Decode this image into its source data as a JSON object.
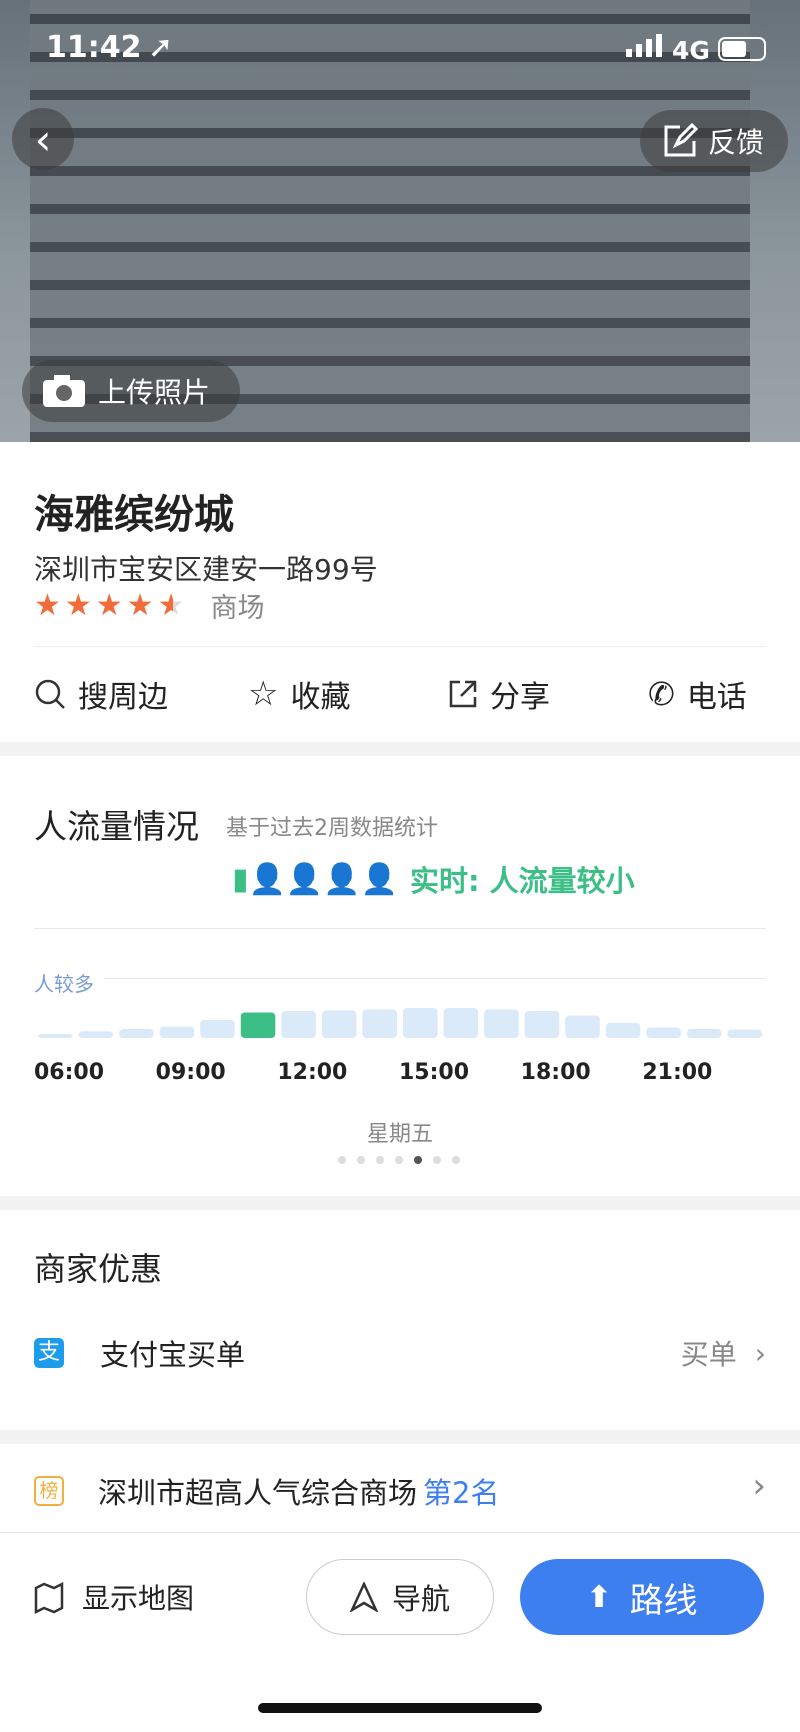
{
  "status": {
    "time": "11:42",
    "network": "4G"
  },
  "hero": {
    "feedback": "反馈",
    "upload": "上传照片"
  },
  "place": {
    "name": "海雅缤纷城",
    "address": "深圳市宝安区建安一路99号",
    "rating": 4.5,
    "category": "商场"
  },
  "actions": {
    "nearby": "搜周边",
    "favorite": "收藏",
    "share": "分享",
    "phone": "电话"
  },
  "traffic": {
    "title": "人流量情况",
    "subtitle": "基于过去2周数据统计",
    "realtime": "实时: 人流量较小",
    "busy_label": "人较多",
    "day": "星期五",
    "ticks": [
      "06:00",
      "09:00",
      "12:00",
      "15:00",
      "18:00",
      "21:00"
    ],
    "levels": [
      0.1,
      0.22,
      0.3,
      0.38,
      0.6,
      0.85,
      0.9,
      0.92,
      0.95,
      1,
      1,
      0.95,
      0.9,
      0.75,
      0.5,
      0.35,
      0.3,
      0.28
    ],
    "current_index": 5,
    "page_dots": 7,
    "active_dot": 4
  },
  "deals": {
    "title": "商家优惠",
    "alipay": "支付宝买单",
    "action": "买单"
  },
  "rank": {
    "badge": "榜",
    "text": "深圳市超高人气综合商场",
    "rank": "第2名"
  },
  "bottom": {
    "map": "显示地图",
    "navigate": "导航",
    "route": "路线"
  },
  "colors": {
    "accent": "#3e7ff0",
    "green": "#3bbf86",
    "star": "#f26b3a"
  }
}
